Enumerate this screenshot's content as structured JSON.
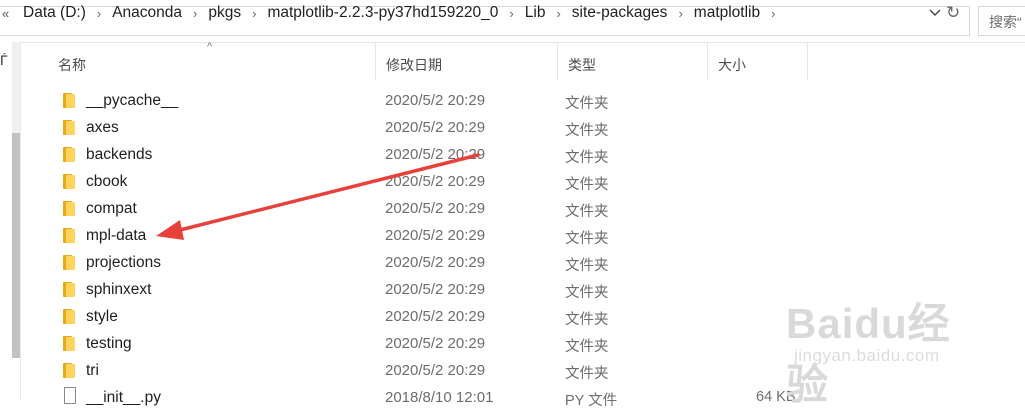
{
  "address_bar": {
    "overflow_icon": "double-chevron-left-icon",
    "crumbs": [
      "Data (D:)",
      "Anaconda",
      "pkgs",
      "matplotlib-2.2.3-py37hd159220_0",
      "Lib",
      "site-packages",
      "matplotlib"
    ],
    "separator": "›",
    "search_placeholder": "搜索“"
  },
  "nav": {
    "fragment": "Ѓ"
  },
  "columns": {
    "name": "名称",
    "modified": "修改日期",
    "type": "类型",
    "size": "大小"
  },
  "rows": [
    {
      "name": "__pycache__",
      "modified": "2020/5/2 20:29",
      "type": "文件夹",
      "size": "",
      "icon": "folder-icon"
    },
    {
      "name": "axes",
      "modified": "2020/5/2 20:29",
      "type": "文件夹",
      "size": "",
      "icon": "folder-icon"
    },
    {
      "name": "backends",
      "modified": "2020/5/2 20:29",
      "type": "文件夹",
      "size": "",
      "icon": "folder-icon"
    },
    {
      "name": "cbook",
      "modified": "2020/5/2 20:29",
      "type": "文件夹",
      "size": "",
      "icon": "folder-icon"
    },
    {
      "name": "compat",
      "modified": "2020/5/2 20:29",
      "type": "文件夹",
      "size": "",
      "icon": "folder-icon"
    },
    {
      "name": "mpl-data",
      "modified": "2020/5/2 20:29",
      "type": "文件夹",
      "size": "",
      "icon": "folder-icon"
    },
    {
      "name": "projections",
      "modified": "2020/5/2 20:29",
      "type": "文件夹",
      "size": "",
      "icon": "folder-icon"
    },
    {
      "name": "sphinxext",
      "modified": "2020/5/2 20:29",
      "type": "文件夹",
      "size": "",
      "icon": "folder-icon"
    },
    {
      "name": "style",
      "modified": "2020/5/2 20:29",
      "type": "文件夹",
      "size": "",
      "icon": "folder-icon"
    },
    {
      "name": "testing",
      "modified": "2020/5/2 20:29",
      "type": "文件夹",
      "size": "",
      "icon": "folder-icon"
    },
    {
      "name": "tri",
      "modified": "2020/5/2 20:29",
      "type": "文件夹",
      "size": "",
      "icon": "folder-icon"
    },
    {
      "name": "__init__.py",
      "modified": "2018/8/10 12:01",
      "type": "PY 文件",
      "size": "64 KB",
      "icon": "python-file-icon"
    }
  ],
  "annotation": {
    "target": "mpl-data",
    "color": "#e8403a"
  },
  "watermark": {
    "logo": "Baidu经验",
    "sub": "jingyan.baidu.com"
  },
  "colors": {
    "folder_back": "#e8a817",
    "folder_front": "#ffd45c",
    "text": "#1f1f1f",
    "muted": "#6d6d6d"
  }
}
